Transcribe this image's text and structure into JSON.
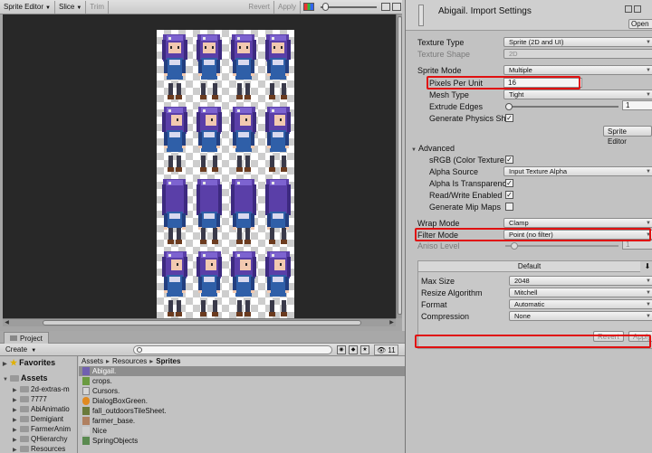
{
  "sprite_editor": {
    "toolbar": {
      "window_menu": "Sprite Editor",
      "slice": "Slice",
      "trim": "Trim",
      "revert": "Revert",
      "apply": "Apply"
    }
  },
  "project": {
    "tab": "Project",
    "create": "Create",
    "count": "11",
    "favorites": "Favorites",
    "assets": "Assets",
    "tree": [
      "2d-extras-m",
      "7777",
      "AbiAnimatio",
      "Demigiant",
      "FarmerAnim",
      "QHierarchy",
      "Resources"
    ],
    "breadcrumb": [
      "Assets",
      "Resources",
      "Sprites"
    ],
    "files": [
      "Abigail.",
      "crops.",
      "Cursors.",
      "DialogBoxGreen.",
      "fall_outdoorsTileSheet.",
      "farmer_base.",
      "Nice",
      "SpringObjects"
    ]
  },
  "inspector": {
    "title": "Abigail. Import Settings",
    "open": "Open",
    "texture_type": {
      "label": "Texture Type",
      "value": "Sprite (2D and UI)"
    },
    "texture_shape": {
      "label": "Texture Shape",
      "value": "2D"
    },
    "sprite_mode": {
      "label": "Sprite Mode",
      "value": "Multiple"
    },
    "pixels_per_unit": {
      "label": "Pixels Per Unit",
      "value": "16"
    },
    "mesh_type": {
      "label": "Mesh Type",
      "value": "Tight"
    },
    "extrude_edges": {
      "label": "Extrude Edges",
      "value": "1"
    },
    "generate_physics": {
      "label": "Generate Physics Sha"
    },
    "sprite_editor_button": "Sprite Editor",
    "advanced": "Advanced",
    "srgb": {
      "label": "sRGB (Color Texture"
    },
    "alpha_source": {
      "label": "Alpha Source",
      "value": "Input Texture Alpha"
    },
    "alpha_transparency": {
      "label": "Alpha Is Transparenc"
    },
    "read_write": {
      "label": "Read/Write Enabled"
    },
    "mipmaps": {
      "label": "Generate Mip Maps"
    },
    "wrap_mode": {
      "label": "Wrap Mode",
      "value": "Clamp"
    },
    "filter_mode": {
      "label": "Filter Mode",
      "value": "Point (no filter)"
    },
    "aniso_level": {
      "label": "Aniso Level",
      "value": "1"
    },
    "platform": {
      "tab": "Default",
      "max_size": {
        "label": "Max Size",
        "value": "2048"
      },
      "resize_algorithm": {
        "label": "Resize Algorithm",
        "value": "Mitchell"
      },
      "format": {
        "label": "Format",
        "value": "Automatic"
      },
      "compression": {
        "label": "Compression",
        "value": "None"
      }
    },
    "revert": "Revert",
    "apply": "Apply"
  }
}
